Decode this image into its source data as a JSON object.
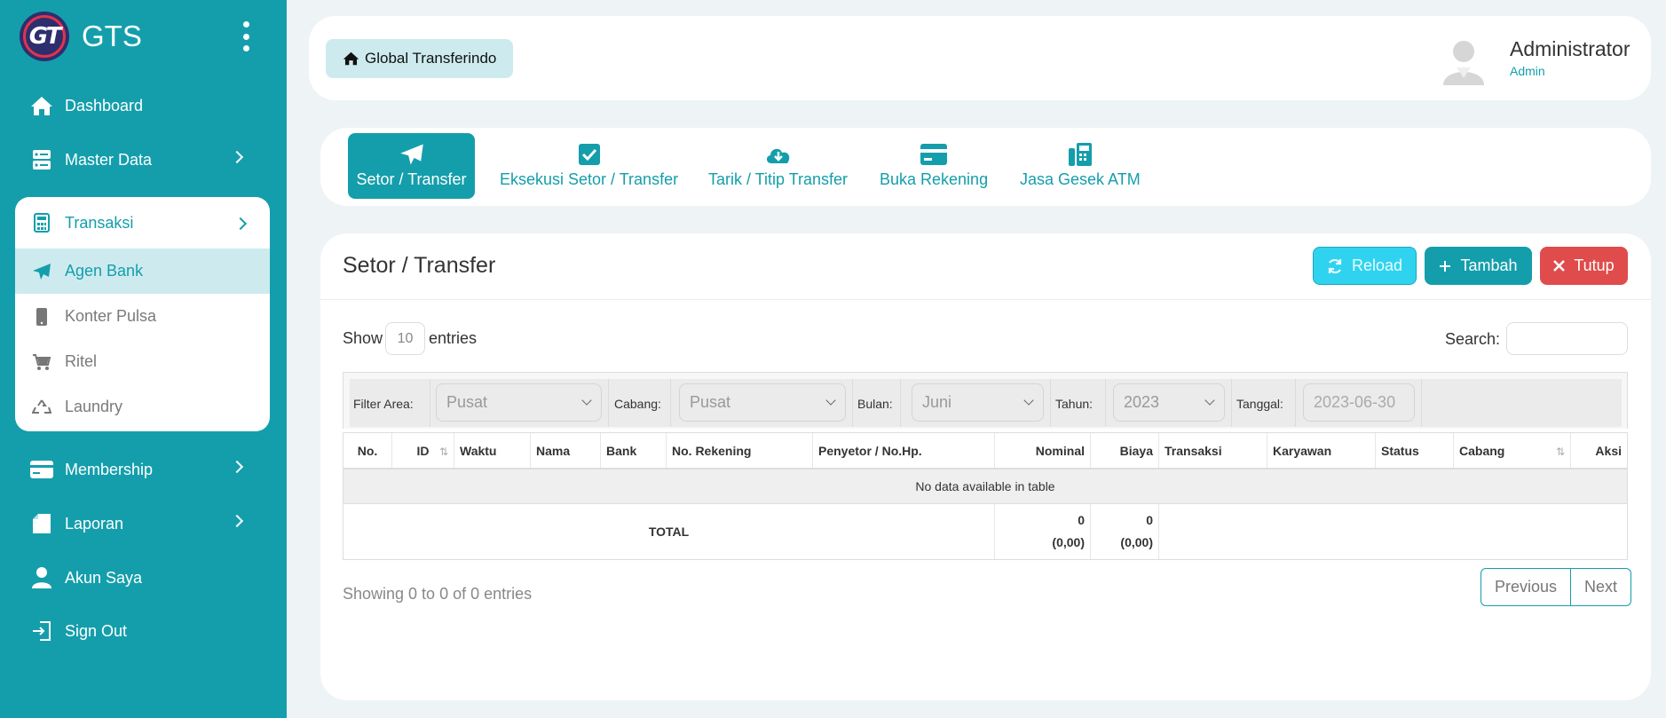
{
  "brand": {
    "logo_text": "GT",
    "name": "GTS"
  },
  "sidebar": {
    "items": [
      {
        "label": "Dashboard"
      },
      {
        "label": "Master Data"
      },
      {
        "label": "Transaksi"
      },
      {
        "label": "Membership"
      },
      {
        "label": "Laporan"
      },
      {
        "label": "Akun Saya"
      },
      {
        "label": "Sign Out"
      }
    ],
    "submenu": [
      {
        "label": "Agen Bank",
        "active": true
      },
      {
        "label": "Konter Pulsa"
      },
      {
        "label": "Ritel"
      },
      {
        "label": "Laundry"
      }
    ]
  },
  "header": {
    "breadcrumb": "Global Transferindo",
    "user_name": "Administrator",
    "user_role": "Admin"
  },
  "tabs": [
    {
      "label": "Setor / Transfer",
      "icon": "paper-plane-icon",
      "active": true
    },
    {
      "label": "Eksekusi Setor / Transfer",
      "icon": "checkbox-icon"
    },
    {
      "label": "Tarik / Titip Transfer",
      "icon": "cloud-download-icon"
    },
    {
      "label": "Buka Rekening",
      "icon": "credit-card-icon"
    },
    {
      "label": "Jasa Gesek ATM",
      "icon": "fax-icon"
    }
  ],
  "main": {
    "title": "Setor / Transfer",
    "buttons": {
      "reload": "Reload",
      "tambah": "Tambah",
      "tutup": "Tutup"
    },
    "show_label": "Show",
    "page_length": "10",
    "entries_label": "entries",
    "search_label": "Search:",
    "filters": {
      "area_label": "Filter Area:",
      "area_value": "Pusat",
      "cabang_label": "Cabang:",
      "cabang_value": "Pusat",
      "bulan_label": "Bulan:",
      "bulan_value": "Juni",
      "tahun_label": "Tahun:",
      "tahun_value": "2023",
      "tanggal_label": "Tanggal:",
      "tanggal_value": "2023-06-30"
    },
    "table": {
      "columns": [
        "No.",
        "ID",
        "Waktu",
        "Nama",
        "Bank",
        "No. Rekening",
        "Penyetor / No.Hp.",
        "Nominal",
        "Biaya",
        "Transaksi",
        "Karyawan",
        "Status",
        "Cabang",
        "Aksi"
      ],
      "empty_text": "No data available in table",
      "total_label": "TOTAL",
      "nominal_total": "0",
      "nominal_total_sub": "(0,00)",
      "biaya_total": "0",
      "biaya_total_sub": "(0,00)"
    },
    "info": "Showing 0 to 0 of 0 entries",
    "pager": {
      "previous": "Previous",
      "next": "Next"
    }
  },
  "colors": {
    "accent": "#149eab",
    "reload": "#2fd3ef",
    "danger": "#e04b4b"
  }
}
